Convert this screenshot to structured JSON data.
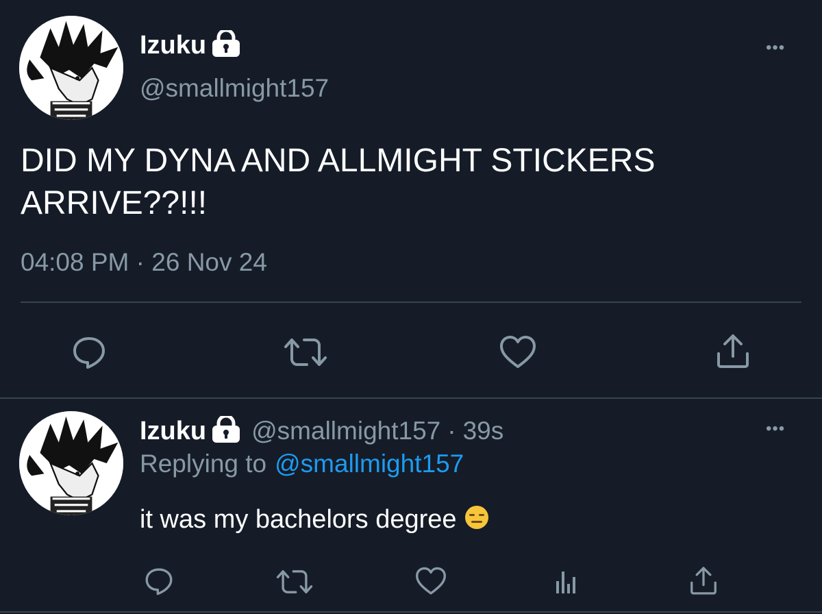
{
  "main_tweet": {
    "author_name": "Izuku",
    "handle": "@smallmight157",
    "text_line1": "DID MY DYNA AND ALLMIGHT STICKERS",
    "text_line2": "ARRIVE??!!!",
    "time": "04:08 PM",
    "separator": "·",
    "date": "26 Nov 24",
    "more_label": "•••",
    "actions": [
      "reply-icon",
      "retweet-icon",
      "like-icon",
      "share-icon"
    ]
  },
  "reply_tweet": {
    "author_name": "Izuku",
    "handle": "@smallmight157",
    "separator": "·",
    "age": "39s",
    "replying_prefix": "Replying to",
    "replying_handle": "@smallmight157",
    "text": "it was my bachelors degree",
    "emoji": "expressionless-face-emoji",
    "more_label": "•••",
    "actions": [
      "reply-icon",
      "retweet-icon",
      "like-icon",
      "analytics-icon",
      "share-icon"
    ]
  },
  "colors": {
    "background": "#151c28",
    "text": "#ffffff",
    "muted": "#8899a6",
    "link": "#1d9bf0",
    "divider": "#38444d"
  }
}
